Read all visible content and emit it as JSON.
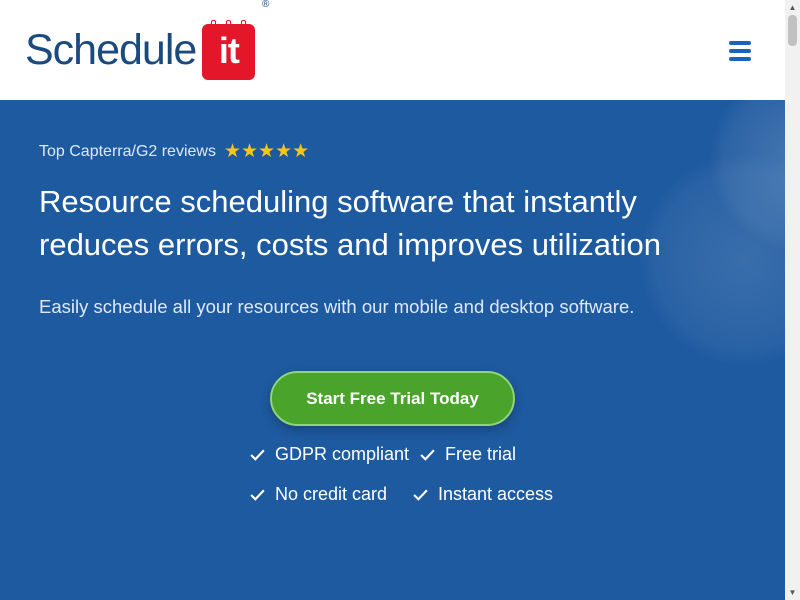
{
  "header": {
    "logo_word": "Schedule",
    "logo_badge": "it",
    "logo_reg": "®",
    "menu_icon": "hamburger-icon"
  },
  "hero": {
    "rating_text": "Top Capterra/G2 reviews",
    "stars": "★★★★★",
    "headline_line1": "Resource scheduling software that instantly",
    "headline_line2": "reduces errors, costs and improves utilization",
    "subline": "Easily schedule all your resources with our mobile and desktop software.",
    "cta_label": "Start Free Trial Today",
    "features": [
      "GDPR compliant",
      "Free trial",
      "No credit card",
      "Instant access"
    ]
  },
  "scrollbar": {
    "up": "▲",
    "down": "▼"
  },
  "colors": {
    "brand_blue": "#1b4a7f",
    "hero_bg": "#1e5aa0",
    "cta_green": "#4aa32a",
    "logo_red": "#e3162a",
    "star_gold": "#f5c518"
  }
}
